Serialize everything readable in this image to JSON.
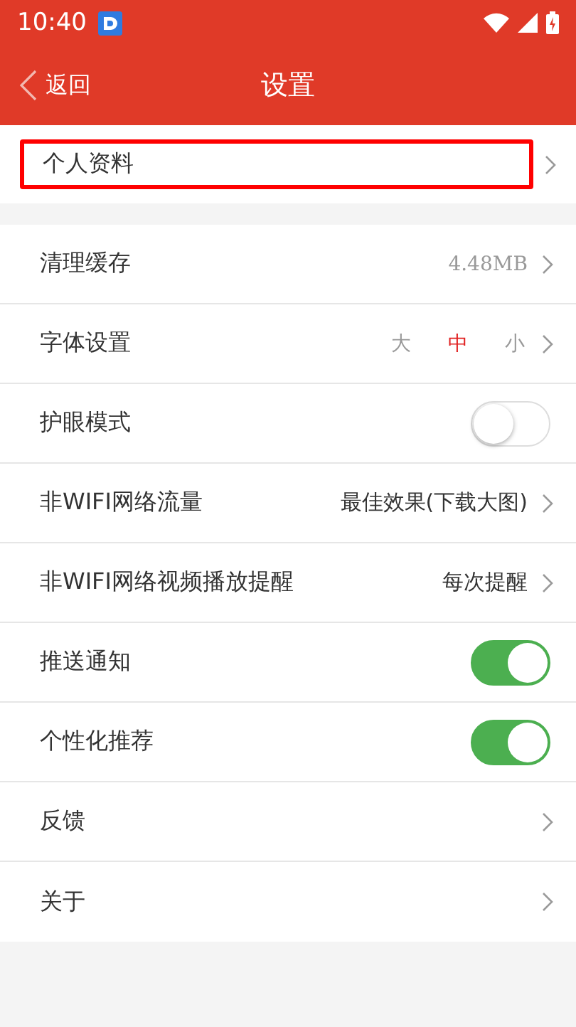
{
  "status_bar": {
    "time": "10:40"
  },
  "nav": {
    "back": "返回",
    "title": "设置"
  },
  "profile": {
    "label": "个人资料",
    "highlighted": true
  },
  "settings": [
    {
      "kind": "value",
      "label": "清理缓存",
      "value": "4.48MB"
    },
    {
      "kind": "options",
      "label": "字体设置",
      "options": [
        {
          "label": "大",
          "selected": false
        },
        {
          "label": "中",
          "selected": true
        },
        {
          "label": "小",
          "selected": false
        }
      ]
    },
    {
      "kind": "toggle",
      "label": "护眼模式",
      "on": false
    },
    {
      "kind": "value",
      "label": "非WIFI网络流量",
      "value": "最佳效果(下载大图)"
    },
    {
      "kind": "value",
      "label": "非WIFI网络视频播放提醒",
      "value": "每次提醒"
    },
    {
      "kind": "toggle",
      "label": "推送通知",
      "on": true
    },
    {
      "kind": "toggle",
      "label": "个性化推荐",
      "on": true
    },
    {
      "kind": "link",
      "label": "反馈"
    },
    {
      "kind": "link",
      "label": "关于"
    }
  ]
}
